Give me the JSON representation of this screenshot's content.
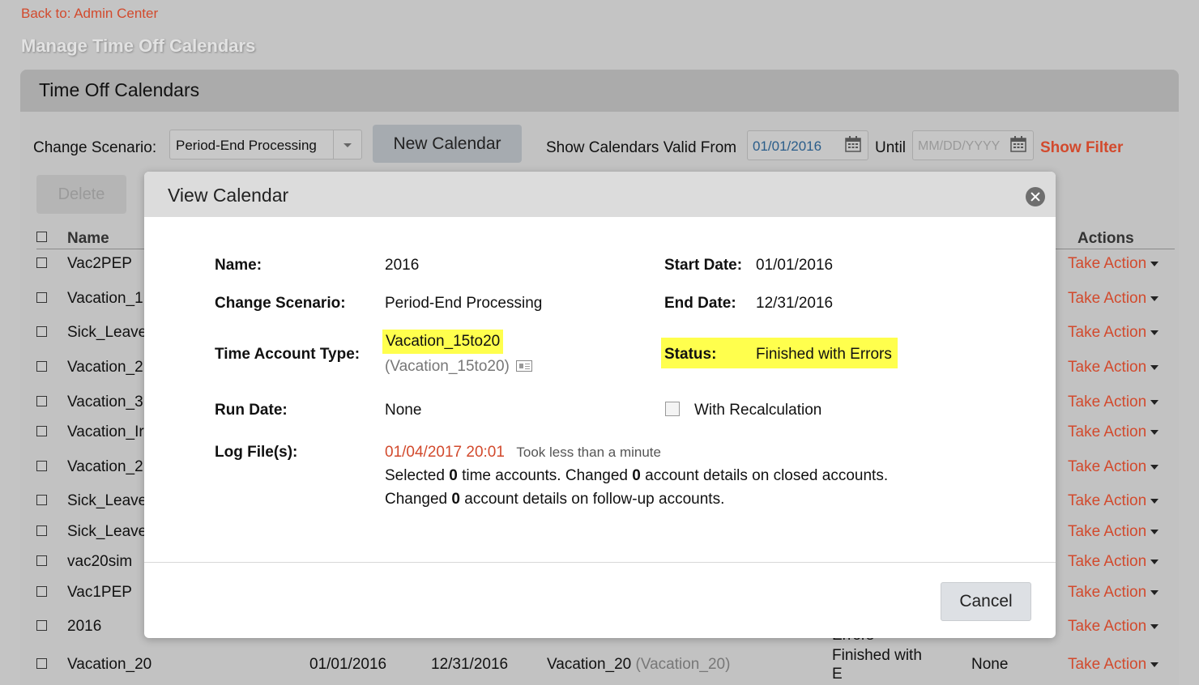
{
  "nav": {
    "back_link": "Back to: Admin Center",
    "page_title": "Manage Time Off Calendars"
  },
  "panel": {
    "title": "Time Off Calendars"
  },
  "toolbar": {
    "change_scenario_label": "Change Scenario:",
    "change_scenario_value": "Period-End Processing",
    "new_calendar": "New Calendar",
    "valid_from_label": "Show Calendars Valid From",
    "valid_from_value": "01/01/2016",
    "until_label": "Until",
    "until_placeholder": "MM/DD/YYYY",
    "show_filter": "Show Filter",
    "delete": "Delete"
  },
  "table": {
    "col_name": "Name",
    "col_actions": "Actions",
    "action_label": "Take Action",
    "rows": [
      {
        "name": "Vac2PEP"
      },
      {
        "name": "Vacation_1"
      },
      {
        "name": "Sick_Leave"
      },
      {
        "name": "Vacation_2"
      },
      {
        "name": "Vacation_3"
      },
      {
        "name": "Vacation_Ir"
      },
      {
        "name": "Vacation_2"
      },
      {
        "name": "Sick_Leave"
      },
      {
        "name": "Sick_Leave"
      },
      {
        "name": "vac20sim"
      },
      {
        "name": "Vac1PEP"
      },
      {
        "name": "2016"
      }
    ],
    "partial_row": {
      "name": "Vacation_20",
      "start": "01/01/2016",
      "end": "12/31/2016",
      "type": "Vacation_20",
      "type_ext": "(Vacation_20)",
      "status_above": "Errors",
      "status": "Finished with",
      "status_cont": "E",
      "run": "None",
      "action": "Take Action"
    }
  },
  "modal": {
    "title": "View Calendar",
    "name_label": "Name:",
    "name_value": "2016",
    "scenario_label": "Change Scenario:",
    "scenario_value": "Period-End Processing",
    "type_label": "Time Account Type:",
    "type_value": "Vacation_15to20",
    "type_ext": "(Vacation_15to20)",
    "run_label": "Run Date:",
    "run_value": "None",
    "log_label": "Log File(s):",
    "log_date": "01/04/2017 20:01",
    "log_duration": "Took less than a minute",
    "log_line1_a": "Selected ",
    "log_line1_b": "0",
    "log_line1_c": " time accounts. Changed ",
    "log_line1_d": "0",
    "log_line1_e": " account details on closed accounts.",
    "log_line2_a": "Changed ",
    "log_line2_b": "0",
    "log_line2_c": " account details on follow-up accounts.",
    "start_label": "Start Date:",
    "start_value": "01/01/2016",
    "end_label": "End Date:",
    "end_value": "12/31/2016",
    "status_label": "Status:",
    "status_value": "Finished with Errors",
    "recalc_label": "With Recalculation",
    "recalc_checked": false,
    "cancel": "Cancel"
  },
  "colors": {
    "accent": "#d24a2d",
    "highlight": "#ffff4d"
  }
}
